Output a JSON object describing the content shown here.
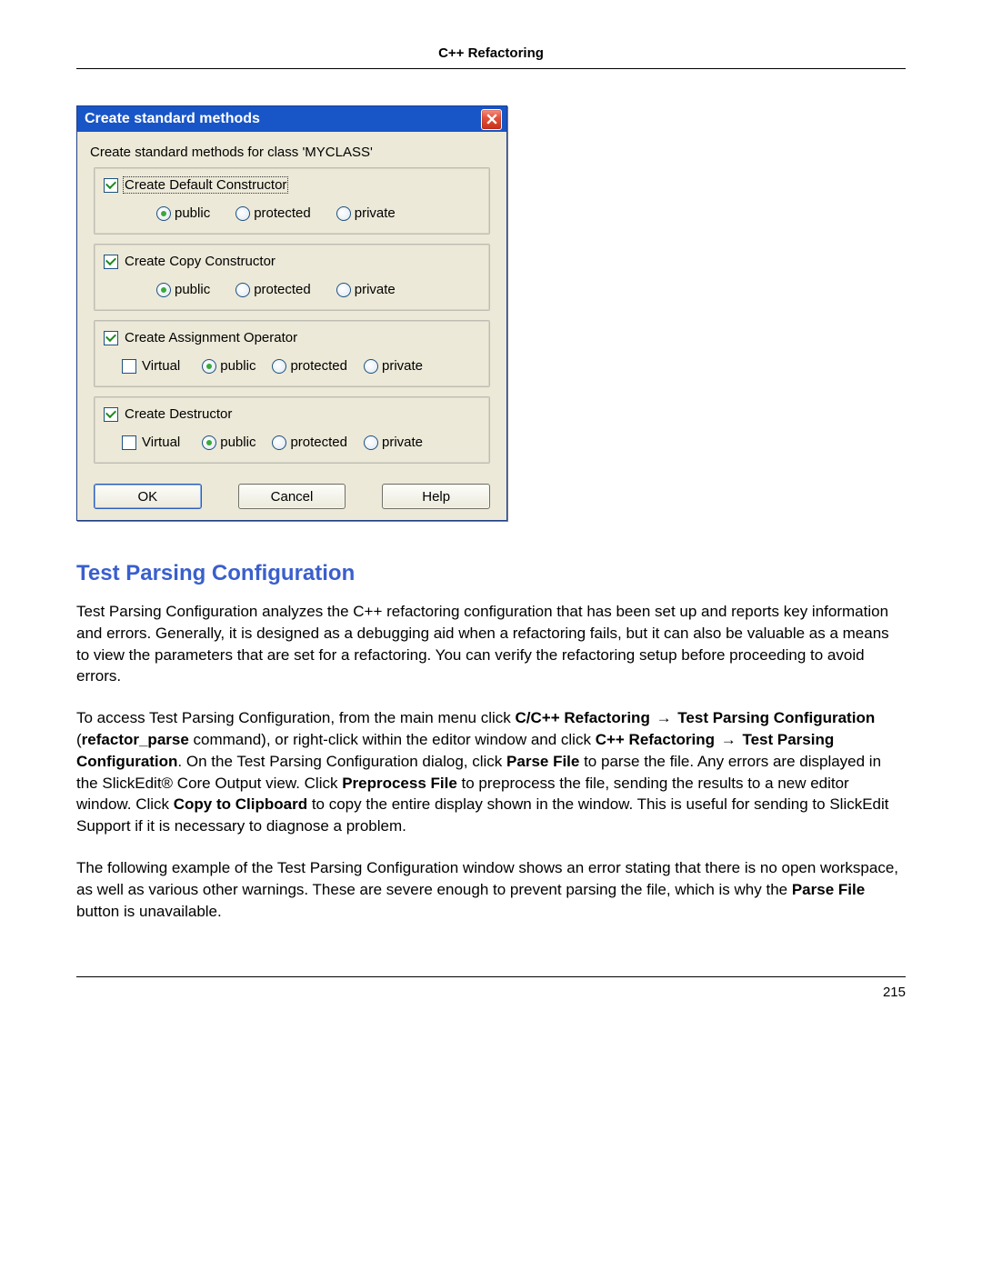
{
  "header": {
    "title": "C++ Refactoring"
  },
  "dialog": {
    "title": "Create standard methods",
    "intro": "Create standard methods for class 'MYCLASS'",
    "groups": {
      "defaultCtor": {
        "label": "Create Default Constructor",
        "access": {
          "public": "public",
          "protected": "protected",
          "private": "private"
        }
      },
      "copyCtor": {
        "label": "Create Copy Constructor",
        "access": {
          "public": "public",
          "protected": "protected",
          "private": "private"
        }
      },
      "assignOp": {
        "label": "Create Assignment Operator",
        "virtual": "Virtual",
        "access": {
          "public": "public",
          "protected": "protected",
          "private": "private"
        }
      },
      "destructor": {
        "label": "Create Destructor",
        "virtual": "Virtual",
        "access": {
          "public": "public",
          "protected": "protected",
          "private": "private"
        }
      }
    },
    "buttons": {
      "ok": "OK",
      "cancel": "Cancel",
      "help": "Help"
    }
  },
  "section": {
    "heading": "Test Parsing Configuration"
  },
  "body": {
    "p1": "Test Parsing Configuration analyzes the C++ refactoring configuration that has been set up and reports key information and errors. Generally, it is designed as a debugging aid when a refactoring fails, but it can also be valuable as a means to view the parameters that are set for a refactoring. You can verify the refactoring setup before proceeding to avoid errors.",
    "p2_pre": "To access Test Parsing Configuration, from the main menu click ",
    "p2_b1": "C/C++ Refactoring",
    "p2_arrow": "→",
    "p2_b2": "Test Parsing Configuration",
    "p2_paren1": " (",
    "p2_b3": "refactor_parse",
    "p2_mid1": " command), or right-click within the editor window and click ",
    "p2_b4": "C++ Refactoring",
    "p2_b5": "Test Parsing Configuration",
    "p2_mid2": ". On the Test Parsing Configuration dialog, click ",
    "p2_b6": "Parse File",
    "p2_mid3": " to parse the file. Any errors are displayed in the SlickEdit® Core Output view. Click ",
    "p2_b7": "Preprocess File",
    "p2_mid4": " to preprocess the file, sending the results to a new editor window. Click ",
    "p2_b8": "Copy to Clipboard",
    "p2_mid5": " to copy the entire display shown in the window. This is useful for sending to SlickEdit Support if it is necessary to diagnose a problem.",
    "p3_pre": "The following example of the Test Parsing Configuration window shows an error stating that there is no open workspace, as well as various other warnings. These are severe enough to prevent parsing the file, which is why the ",
    "p3_b1": "Parse File",
    "p3_post": " button is unavailable."
  },
  "footer": {
    "page": "215"
  }
}
